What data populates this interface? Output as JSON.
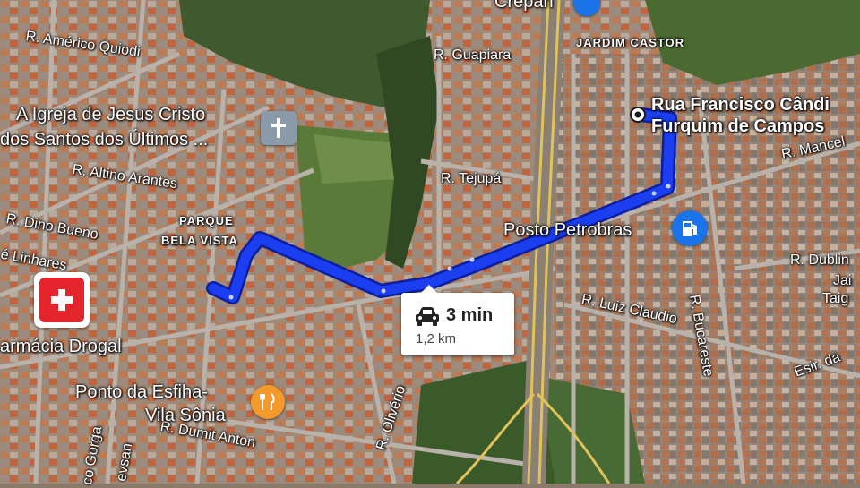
{
  "map": {
    "streets": [
      "R. Américo Quiodi",
      "R. Guapiara",
      "R. Tejupá",
      "R. Altino Arantes",
      "R. Dino Bueno",
      "é Linhares",
      "R. Mancel",
      "R. Dublin",
      "R. Bucareste",
      "R. Luiz Claudio",
      "R. Olivério",
      "R. Dumit Anton",
      "co Gorga",
      "evsan",
      "Esir. da",
      "Jai",
      "Taig"
    ],
    "neighborhoods": [
      "JARDIM CASTOR",
      "PARQUE",
      "BELA VISTA"
    ],
    "places": {
      "church_line1": "A Igreja de Jesus Cristo",
      "church_line2": "dos Santos dos Últimos ...",
      "gas_station": "Posto Petrobras",
      "pharmacy": "armácia Drogal",
      "restaurant_line1": "Ponto da Esfiha-",
      "restaurant_line2": "Vila Sônia",
      "top_partial": "Crepan"
    },
    "destination": {
      "line1": "Rua Francisco Cândi",
      "line2": "Furquim de Campos"
    },
    "route": {
      "time": "3 min",
      "distance": "1,2 km",
      "color": "#1a3ef0"
    },
    "icons": {
      "church": "church-icon",
      "gas": "gas-station-icon",
      "pharmacy": "pharmacy-icon",
      "restaurant": "restaurant-icon",
      "car": "car-icon",
      "destination": "destination-dot-icon",
      "origin": "origin-marker-icon"
    }
  }
}
